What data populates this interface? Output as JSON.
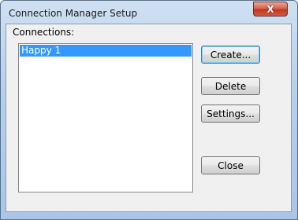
{
  "window": {
    "title": "Connection Manager Setup",
    "close_glyph": "X"
  },
  "connections": {
    "label": "Connections:",
    "items": [
      {
        "label": "Happy 1",
        "selected": true
      }
    ]
  },
  "buttons": {
    "create": "Create...",
    "delete": "Delete",
    "settings": "Settings...",
    "close": "Close"
  },
  "colors": {
    "selection": "#3399ff",
    "close_button": "#c2371f",
    "frame": "#b9d0ea"
  }
}
